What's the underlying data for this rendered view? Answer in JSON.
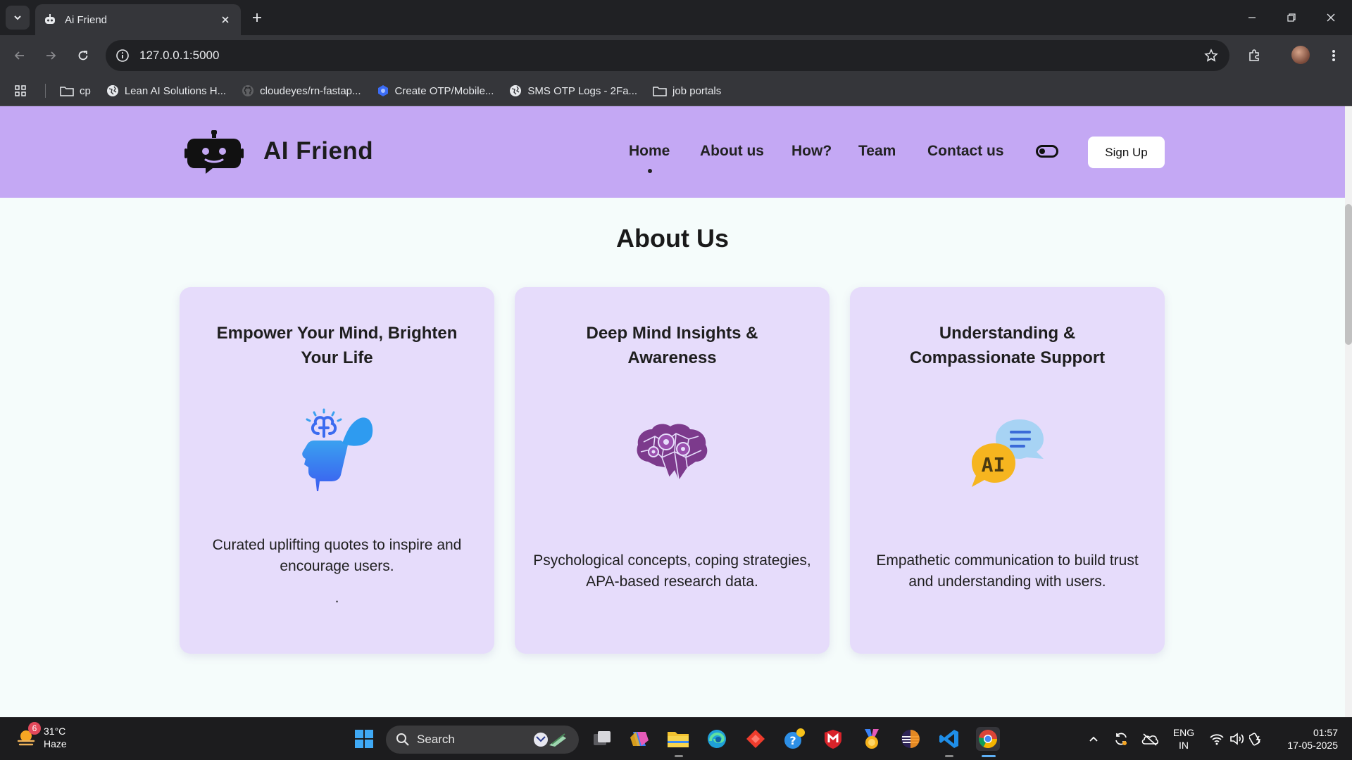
{
  "browser": {
    "tab_title": "Ai Friend",
    "url": "127.0.0.1:5000",
    "bookmarks": [
      {
        "label": "cp",
        "icon": "folder-icon"
      },
      {
        "label": "Lean AI Solutions H...",
        "icon": "globe-icon"
      },
      {
        "label": "cloudeyes/rn-fastap...",
        "icon": "github-icon"
      },
      {
        "label": "Create OTP/Mobile...",
        "icon": "site-icon"
      },
      {
        "label": "SMS OTP Logs - 2Fa...",
        "icon": "globe-icon"
      },
      {
        "label": "job portals",
        "icon": "folder-icon"
      }
    ]
  },
  "site": {
    "logo_text": "AI Friend",
    "nav": [
      "Home",
      "About us",
      "How?",
      "Team",
      "Contact us"
    ],
    "active_nav": "Home",
    "signup_label": "Sign Up",
    "header_color": "#c4a8f4"
  },
  "about": {
    "title": "About Us",
    "cards": [
      {
        "title": "Empower Your Mind, Brighten Your Life",
        "description": "Curated uplifting quotes to inspire and encourage users.",
        "extra": ".",
        "icon": "open-head-brain-icon"
      },
      {
        "title": "Deep Mind Insights & Awareness",
        "description": "Psychological concepts, coping strategies, APA-based research data.",
        "icon": "brain-gears-icon"
      },
      {
        "title": "Understanding & Compassionate Support",
        "description": "Empathetic communication to build trust and understanding with users.",
        "icon": "ai-chat-bubbles-icon",
        "icon_text": "AI"
      }
    ]
  },
  "taskbar": {
    "weather_temp": "31°C",
    "weather_desc": "Haze",
    "weather_badge": "6",
    "search_label": "Search",
    "lang_top": "ENG",
    "lang_bottom": "IN",
    "time": "01:57",
    "date": "17-05-2025"
  }
}
